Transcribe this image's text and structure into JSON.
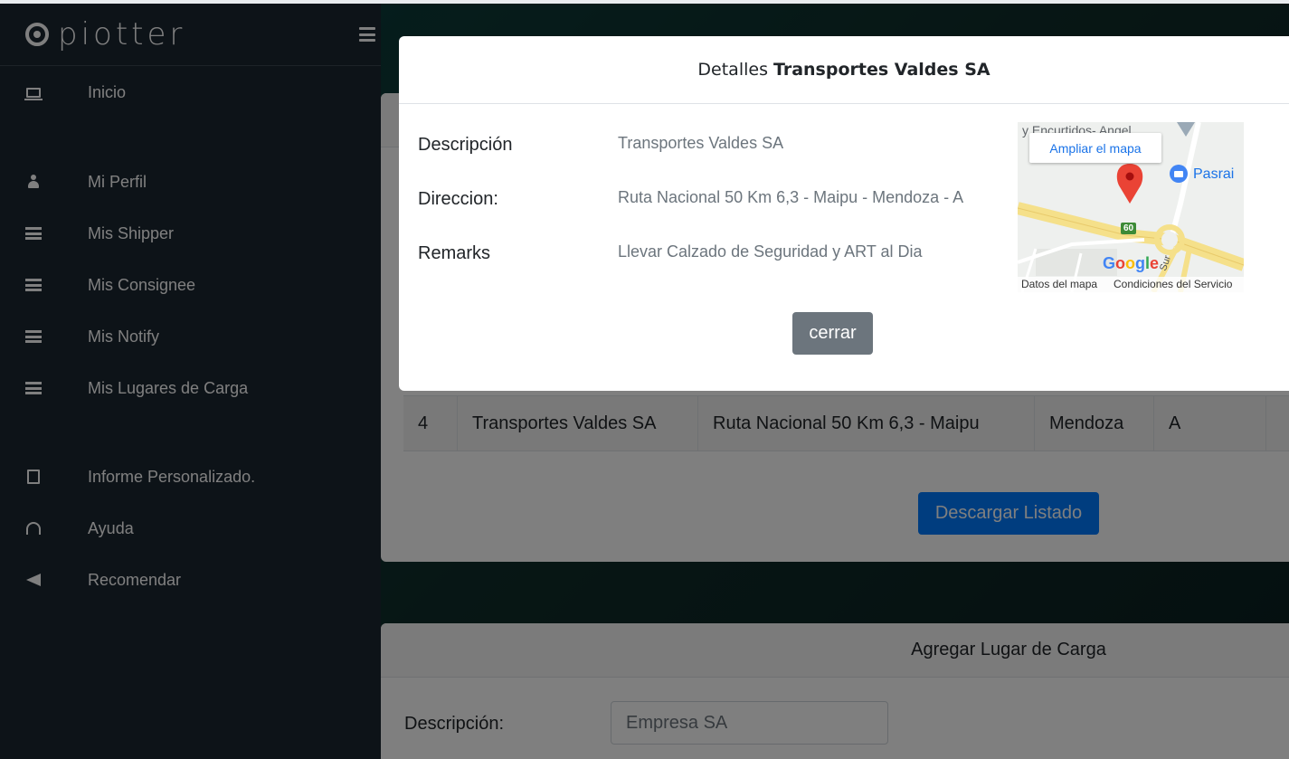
{
  "brand": {
    "name": "piotter"
  },
  "sidebar": {
    "items": [
      {
        "label": "Inicio",
        "icon": "monitor-icon"
      },
      {
        "label": "Mi Perfil",
        "icon": "user-icon"
      },
      {
        "label": "Mis Shipper",
        "icon": "server-icon"
      },
      {
        "label": "Mis Consignee",
        "icon": "server-icon"
      },
      {
        "label": "Mis Notify",
        "icon": "server-icon"
      },
      {
        "label": "Mis Lugares de Carga",
        "icon": "server-icon"
      },
      {
        "label": "Informe Personalizado.",
        "icon": "book-icon"
      },
      {
        "label": "Ayuda",
        "icon": "headset-icon"
      },
      {
        "label": "Recomendar",
        "icon": "megaphone-icon"
      }
    ]
  },
  "table": {
    "row": [
      "4",
      "Transportes Valdes SA",
      "Ruta Nacional 50 Km 6,3 - Maipu",
      "Mendoza",
      "A"
    ]
  },
  "download_button": "Descargar Listado",
  "add_card": {
    "title": "Agregar Lugar de Carga",
    "description_label": "Descripción:",
    "description_placeholder": "Empresa SA"
  },
  "modal": {
    "title_prefix": "Detalles",
    "title_name": "Transportes Valdes SA",
    "fields": [
      {
        "label": "Descripción",
        "value": "Transportes Valdes SA"
      },
      {
        "label": "Direccion:",
        "value": "Ruta Nacional 50 Km 6,3 - Maipu - Mendoza - A"
      },
      {
        "label": "Remarks",
        "value": "Llevar Calzado de Seguridad y ART al Dia"
      }
    ],
    "close_button": "cerrar"
  },
  "map": {
    "link": "Ampliar el mapa",
    "top_text": "y Encurtidos- Angel...",
    "poi": "Pasrai",
    "route_shield": "60",
    "road_label": "Sur",
    "logo": "Google",
    "footer_data": "Datos del mapa",
    "footer_terms": "Condiciones del Servicio"
  },
  "colors": {
    "sidebar_bg": "#1b2631",
    "primary": "#007bff",
    "secondary": "#6c757d",
    "map_pin": "#ea4335"
  }
}
